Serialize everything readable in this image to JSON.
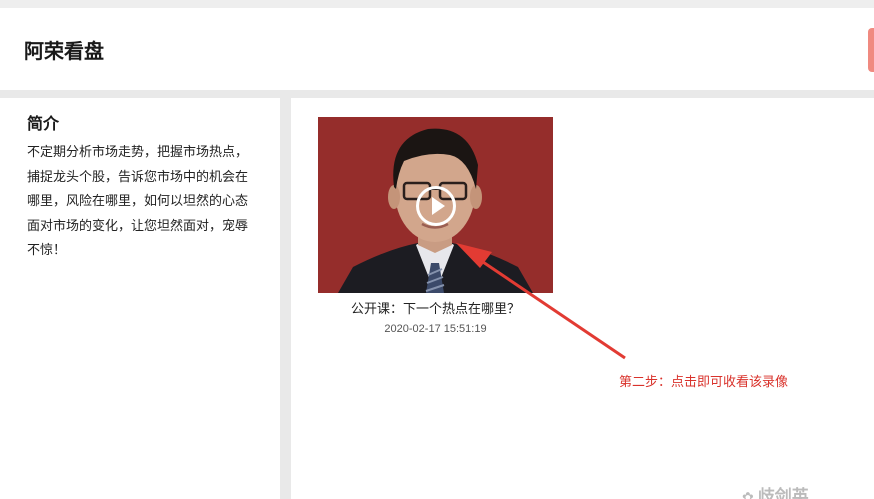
{
  "header": {
    "title": "阿荣看盘"
  },
  "sidebar": {
    "heading": "简介",
    "description": "不定期分析市场走势，把握市场热点，捕捉龙头个股，告诉您市场中的机会在哪里，风险在哪里，如何以坦然的心态面对市场的变化，让您坦然面对，宠辱不惊！"
  },
  "video": {
    "title": "公开课：下一个热点在哪里？",
    "timestamp": "2020-02-17 15:51:19",
    "play_icon": "play-icon"
  },
  "annotation": {
    "text": "第二步：点击即可收看该录像",
    "color": "#d9322b"
  },
  "watermark": {
    "text": "歧剑英"
  },
  "colors": {
    "thumbnail_bg": "#8e2a28",
    "accent_edge": "#f08a80"
  }
}
